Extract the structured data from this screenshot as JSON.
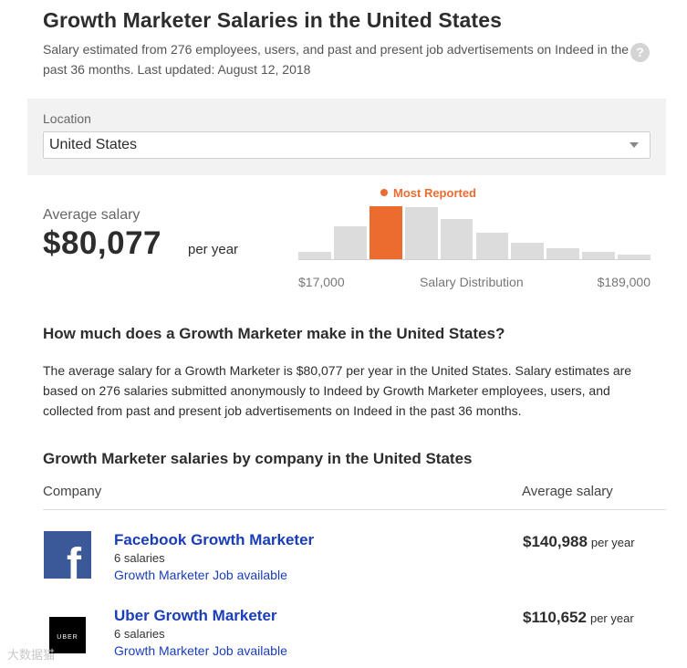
{
  "header": {
    "title": "Growth Marketer Salaries in the United States",
    "subtitle": "Salary estimated from 276 employees, users, and past and present job advertisements on Indeed in the past 36 months. Last updated: August 12, 2018",
    "help_icon": "?"
  },
  "location": {
    "label": "Location",
    "value": "United States"
  },
  "average": {
    "label": "Average salary",
    "amount": "$80,077",
    "unit": "per year"
  },
  "distribution": {
    "highlight_label": "Most Reported",
    "min_label": "$17,000",
    "axis_label": "Salary Distribution",
    "max_label": "$189,000",
    "highlight_index": 2,
    "bar_heights": [
      0.14,
      0.62,
      1.0,
      0.98,
      0.75,
      0.5,
      0.31,
      0.2,
      0.13,
      0.09
    ],
    "colors": {
      "bar": "#dcdcdc",
      "highlight": "#ec6b2f"
    }
  },
  "explanation": {
    "heading": "How much does a Growth Marketer make in the United States?",
    "body": "The average salary for a Growth Marketer is $80,077 per year in the United States. Salary estimates are based on 276 salaries submitted anonymously to Indeed by Growth Marketer employees, users, and collected from past and present job advertisements on Indeed in the past 36 months."
  },
  "companies": {
    "heading": "Growth Marketer salaries by company in the United States",
    "col_company": "Company",
    "col_salary": "Average salary",
    "rows": [
      {
        "name": "Facebook Growth Marketer",
        "count": "6 salaries",
        "jobs": "Growth Marketer Job available",
        "salary": "$140,988",
        "unit": "per year",
        "logo_text": "f"
      },
      {
        "name": "Uber Growth Marketer",
        "count": "6 salaries",
        "jobs": "Growth Marketer Job available",
        "salary": "$110,652",
        "unit": "per year",
        "logo_text": "UBER"
      }
    ]
  },
  "watermark": "大数据猫"
}
